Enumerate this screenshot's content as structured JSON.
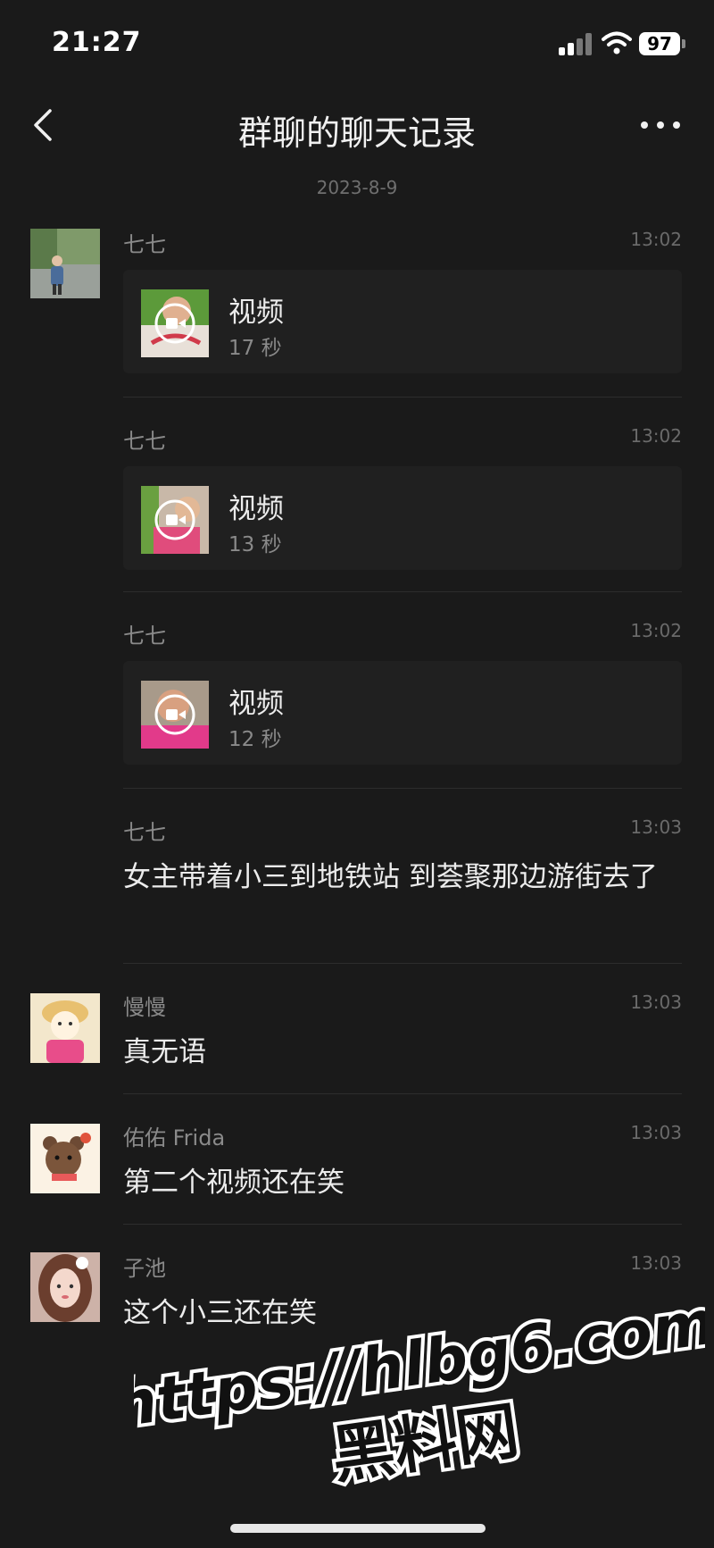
{
  "status": {
    "time": "21:27",
    "battery": "97"
  },
  "nav": {
    "title": "群聊的聊天记录"
  },
  "date": "2023-8-9",
  "messages": [
    {
      "sender": "七七",
      "time": "13:02",
      "type": "video",
      "label": "视频",
      "duration": "17 秒"
    },
    {
      "sender": "七七",
      "time": "13:02",
      "type": "video",
      "label": "视频",
      "duration": "13 秒"
    },
    {
      "sender": "七七",
      "time": "13:02",
      "type": "video",
      "label": "视频",
      "duration": "12 秒"
    },
    {
      "sender": "七七",
      "time": "13:03",
      "type": "text",
      "text": "女主带着小三到地铁站 到荟聚那边游街去了"
    },
    {
      "sender": "慢慢",
      "time": "13:03",
      "type": "text",
      "text": "真无语"
    },
    {
      "sender": "佑佑 Frida",
      "time": "13:03",
      "type": "text",
      "text": "第二个视频还在笑"
    },
    {
      "sender": "子池",
      "time": "13:03",
      "type": "text",
      "text": "这个小三还在笑"
    }
  ],
  "watermark": {
    "line1": "https://hlbg6.com",
    "line2": "黑料网"
  },
  "colors": {
    "background": "#1a1a1a",
    "card": "#202020",
    "text": "#ececec",
    "secondary": "#8a8a8a"
  }
}
